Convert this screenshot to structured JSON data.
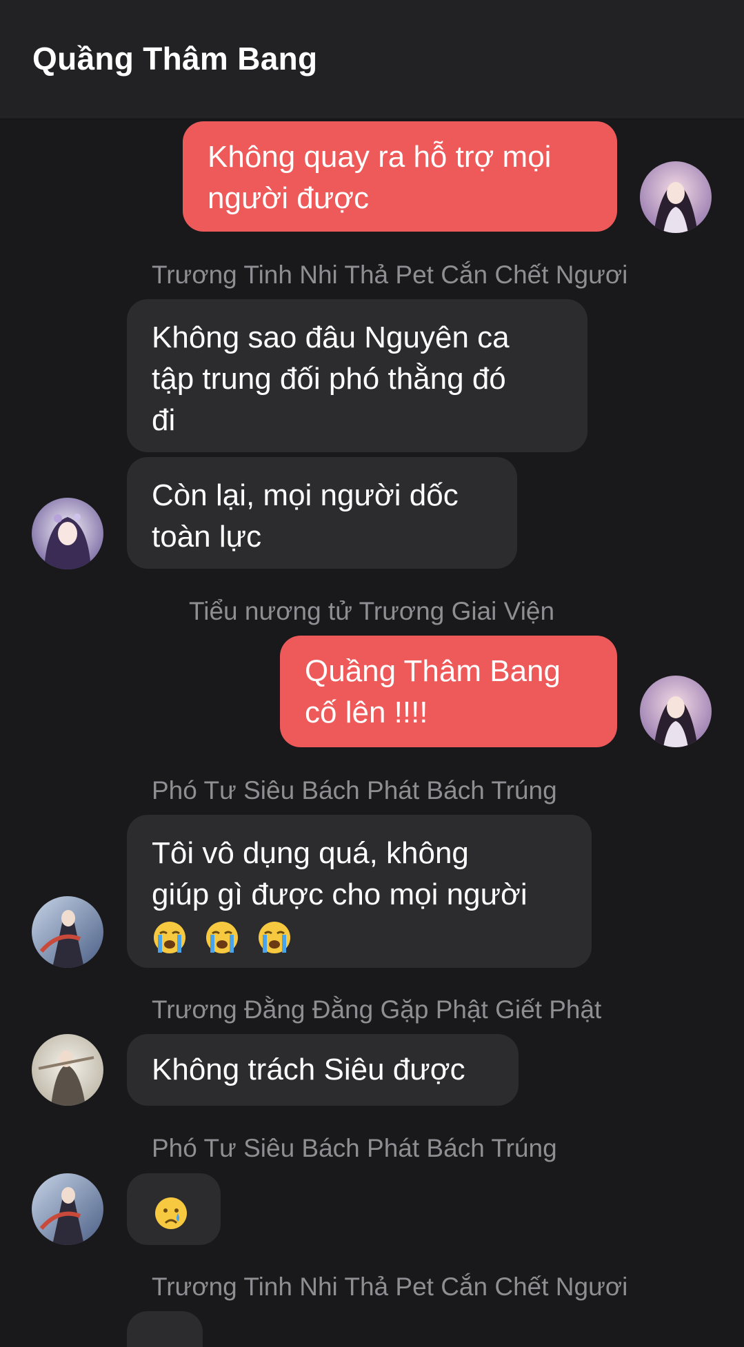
{
  "header": {
    "title": "Quầng Thâm Bang"
  },
  "messages": [
    {
      "lines": [
        "Không quay ra hỗ trợ mọi",
        "người được"
      ]
    },
    {
      "sender": "Trương Tinh Nhi Thả Pet Cắn Chết Ngươi"
    },
    {
      "lines": [
        "Không sao đâu Nguyên ca",
        "tập trung đối phó thằng đó",
        "đi"
      ]
    },
    {
      "lines": [
        "Còn lại, mọi người dốc",
        "toàn lực"
      ]
    },
    {
      "sender": "Tiểu nương tử Trương Giai Viện"
    },
    {
      "lines": [
        "Quầng Thâm Bang",
        "cố lên !!!!"
      ]
    },
    {
      "sender": "Phó Tư Siêu Bách Phát Bách Trúng"
    },
    {
      "lines": [
        "Tôi vô dụng quá, không",
        "giúp gì được cho mọi người"
      ],
      "emojis": [
        "loudly-crying-face",
        "loudly-crying-face",
        "loudly-crying-face"
      ]
    },
    {
      "sender": "Trương Đằng Đằng Gặp Phật Giết Phật"
    },
    {
      "lines": [
        "Không trách Siêu được"
      ]
    },
    {
      "sender": "Phó Tư Siêu Bách Phát Bách Trúng"
    },
    {
      "emojis": [
        "crying-face"
      ]
    },
    {
      "sender": "Trương Tinh Nhi Thả Pet Cắn Chết Ngươi"
    }
  ],
  "colors": {
    "background": "#19191c",
    "header": "#222224",
    "incoming_bubble": "#2c2c2e",
    "outgoing_bubble": "#ee5959",
    "sender_name": "#8e8e93"
  }
}
